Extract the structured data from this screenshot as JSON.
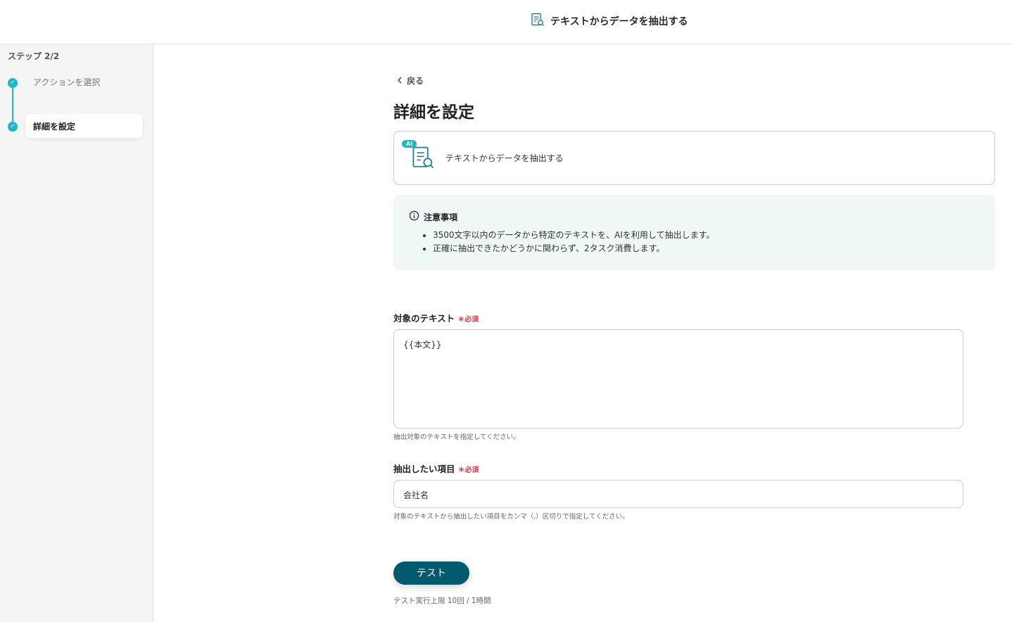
{
  "header": {
    "title": "テキストからデータを抽出する",
    "icon": "document-search-icon"
  },
  "sidebar": {
    "step_label": "ステップ 2/2",
    "steps": [
      {
        "label": "アクションを選択",
        "done": true
      },
      {
        "label": "詳細を設定",
        "done": true,
        "active": true
      }
    ]
  },
  "main": {
    "back_label": "戻る",
    "page_title": "詳細を設定",
    "action_card": {
      "badge": "AI",
      "label": "テキストからデータを抽出する"
    },
    "notice": {
      "title": "注意事項",
      "items": [
        "3500文字以内のデータから特定のテキストを、AIを利用して抽出します。",
        "正確に抽出できたかどうかに関わらず、2タスク消費します。"
      ]
    },
    "fields": [
      {
        "label": "対象のテキスト",
        "required": "必須",
        "value": "{{本文}}",
        "help": "抽出対象のテキストを指定してください。"
      },
      {
        "label": "抽出したい項目",
        "required": "必須",
        "value": "会社名",
        "help": "対象のテキストから抽出したい項目をカンマ（,）区切りで指定してください。"
      }
    ],
    "test_button": "テスト",
    "test_limit": "テスト実行上限 10回 / 1時間"
  },
  "colors": {
    "accent": "#1bb8c9",
    "button": "#035a6f",
    "required": "#e8334a",
    "notice_bg": "#f0f7f7"
  }
}
